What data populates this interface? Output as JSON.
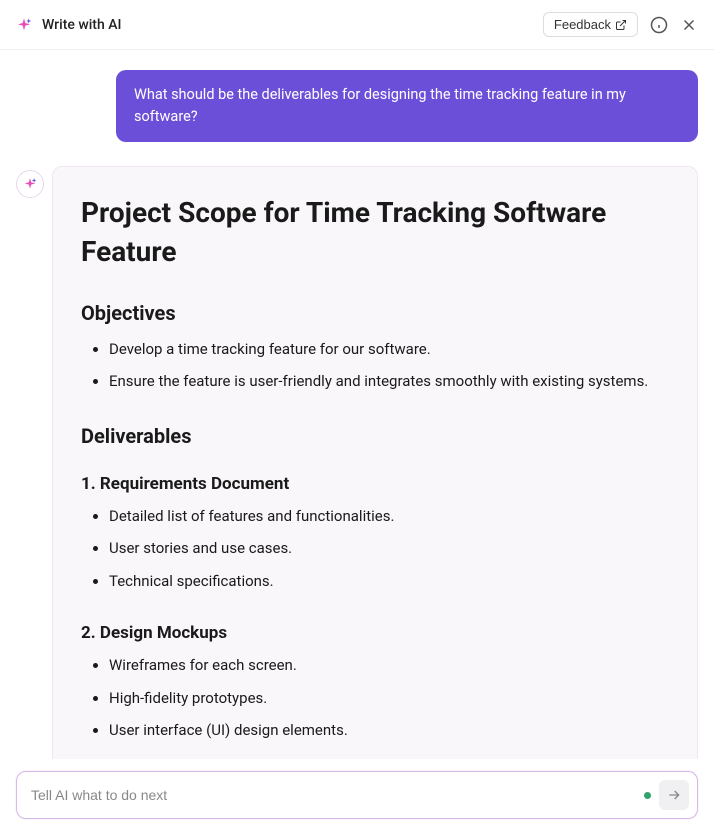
{
  "header": {
    "title": "Write with AI",
    "feedback_label": "Feedback"
  },
  "conversation": {
    "user_message": "What should be the deliverables for designing the time tracking feature in my software?"
  },
  "response": {
    "title": "Project Scope for Time Tracking Software Feature",
    "section_objectives": {
      "heading": "Objectives",
      "items": [
        "Develop a time tracking feature for our software.",
        "Ensure the feature is user-friendly and integrates smoothly with existing systems."
      ]
    },
    "section_deliverables": {
      "heading": "Deliverables",
      "sub1": {
        "heading": "1. Requirements Document",
        "items": [
          "Detailed list of features and functionalities.",
          "User stories and use cases.",
          "Technical specifications."
        ]
      },
      "sub2": {
        "heading": "2. Design Mockups",
        "items": [
          "Wireframes for each screen.",
          "High-fidelity prototypes.",
          "User interface (UI) design elements."
        ]
      }
    }
  },
  "input": {
    "placeholder": "Tell AI what to do next"
  }
}
